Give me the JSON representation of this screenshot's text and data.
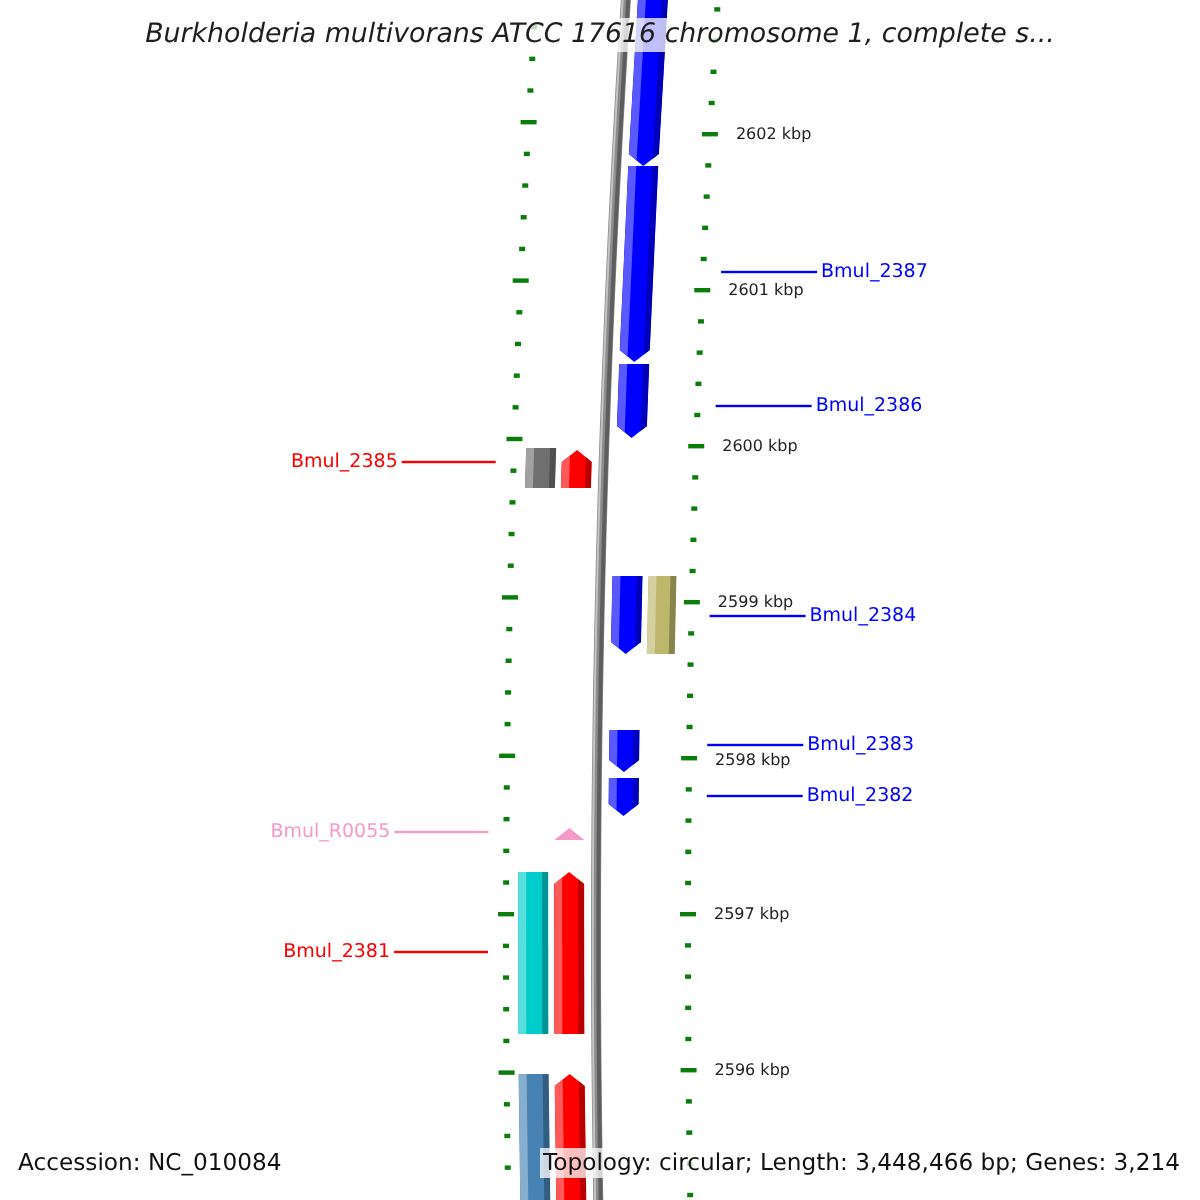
{
  "title": "Burkholderia multivorans ATCC 17616 chromosome 1, complete s...",
  "scale_labels": [
    "2602 kbp",
    "2601 kbp",
    "2600 kbp",
    "2599 kbp",
    "2598 kbp",
    "2597 kbp",
    "2596 kbp"
  ],
  "features": [
    {
      "kind": "arrow",
      "reverse": false,
      "color": "#0000ff"
    },
    {
      "kind": "arrow",
      "reverse": false,
      "color": "#0000ff",
      "label": "Bmul_2387"
    },
    {
      "kind": "arrow",
      "reverse": false,
      "color": "#0000ff",
      "label": "Bmul_2386"
    },
    {
      "kind": "block",
      "reverse": true,
      "color": "#6f6f6f"
    },
    {
      "kind": "arrow",
      "reverse": true,
      "color": "#ff0000",
      "label": "Bmul_2385"
    },
    {
      "kind": "arrow",
      "reverse": false,
      "color": "#0000ff",
      "label": "Bmul_2384"
    },
    {
      "kind": "block",
      "reverse": false,
      "color": "#bdb76b"
    },
    {
      "kind": "arrow",
      "reverse": false,
      "color": "#0000ff",
      "label": "Bmul_2383"
    },
    {
      "kind": "arrow",
      "reverse": false,
      "color": "#0000ff",
      "label": "Bmul_2382"
    },
    {
      "kind": "triangle",
      "reverse": true,
      "color": "#f59ac8",
      "label": "Bmul_R0055"
    },
    {
      "kind": "block",
      "reverse": true,
      "color": "#00cccc"
    },
    {
      "kind": "arrow",
      "reverse": true,
      "color": "#ff0000",
      "label": "Bmul_2381"
    },
    {
      "kind": "block",
      "reverse": true,
      "color": "#4682b4"
    },
    {
      "kind": "arrow",
      "reverse": true,
      "color": "#ff0000"
    }
  ],
  "footer": {
    "accession": "Accession: NC_010084",
    "summary": "Topology: circular; Length: 3,448,466 bp; Genes: 3,214"
  }
}
